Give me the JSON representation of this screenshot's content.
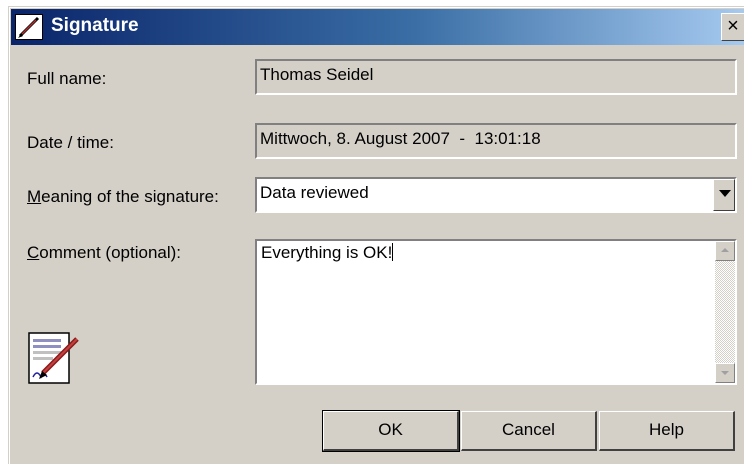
{
  "window": {
    "title": "Signature",
    "close_label": "×"
  },
  "form": {
    "full_name_label": "Full name:",
    "full_name_value": "Thomas Seidel",
    "datetime_label": "Date / time:",
    "datetime_value": "Mittwoch, 8. August 2007  -  13:01:18",
    "meaning_label_prefix": "M",
    "meaning_label_rest": "eaning of the signature:",
    "meaning_value": "Data reviewed",
    "comment_label_prefix": "C",
    "comment_label_rest": "omment (optional):",
    "comment_value": "Everything is OK!"
  },
  "buttons": {
    "ok_label": "OK",
    "cancel_label": "Cancel",
    "help_label": "Help"
  },
  "icons": {
    "title_icon": "pen-icon",
    "signature_icon": "signed-document-icon"
  }
}
